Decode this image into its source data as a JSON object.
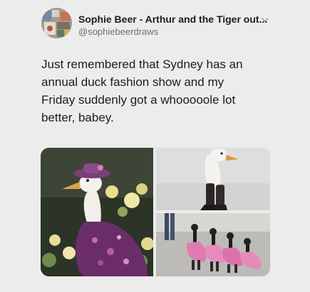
{
  "tweet": {
    "author_name": "Sophie Beer - Arthur and the Tiger out...",
    "author_handle": "@sophiebeerdraws",
    "text": "Just remembered that Sydney has an\nannual duck fashion show and my\nFriday suddenly got a whooooole lot\nbetter, babey.",
    "menu_icon": "chevron-down-icon"
  },
  "media": {
    "photos": [
      {
        "subject": "duck in purple floral dress and hat"
      },
      {
        "subject": "duck in black boots"
      },
      {
        "subject": "ducks in pink tutus walking"
      }
    ]
  },
  "colors": {
    "background": "#ececec",
    "name_text": "#1d1d1d",
    "handle_text": "#6e6e6e"
  }
}
